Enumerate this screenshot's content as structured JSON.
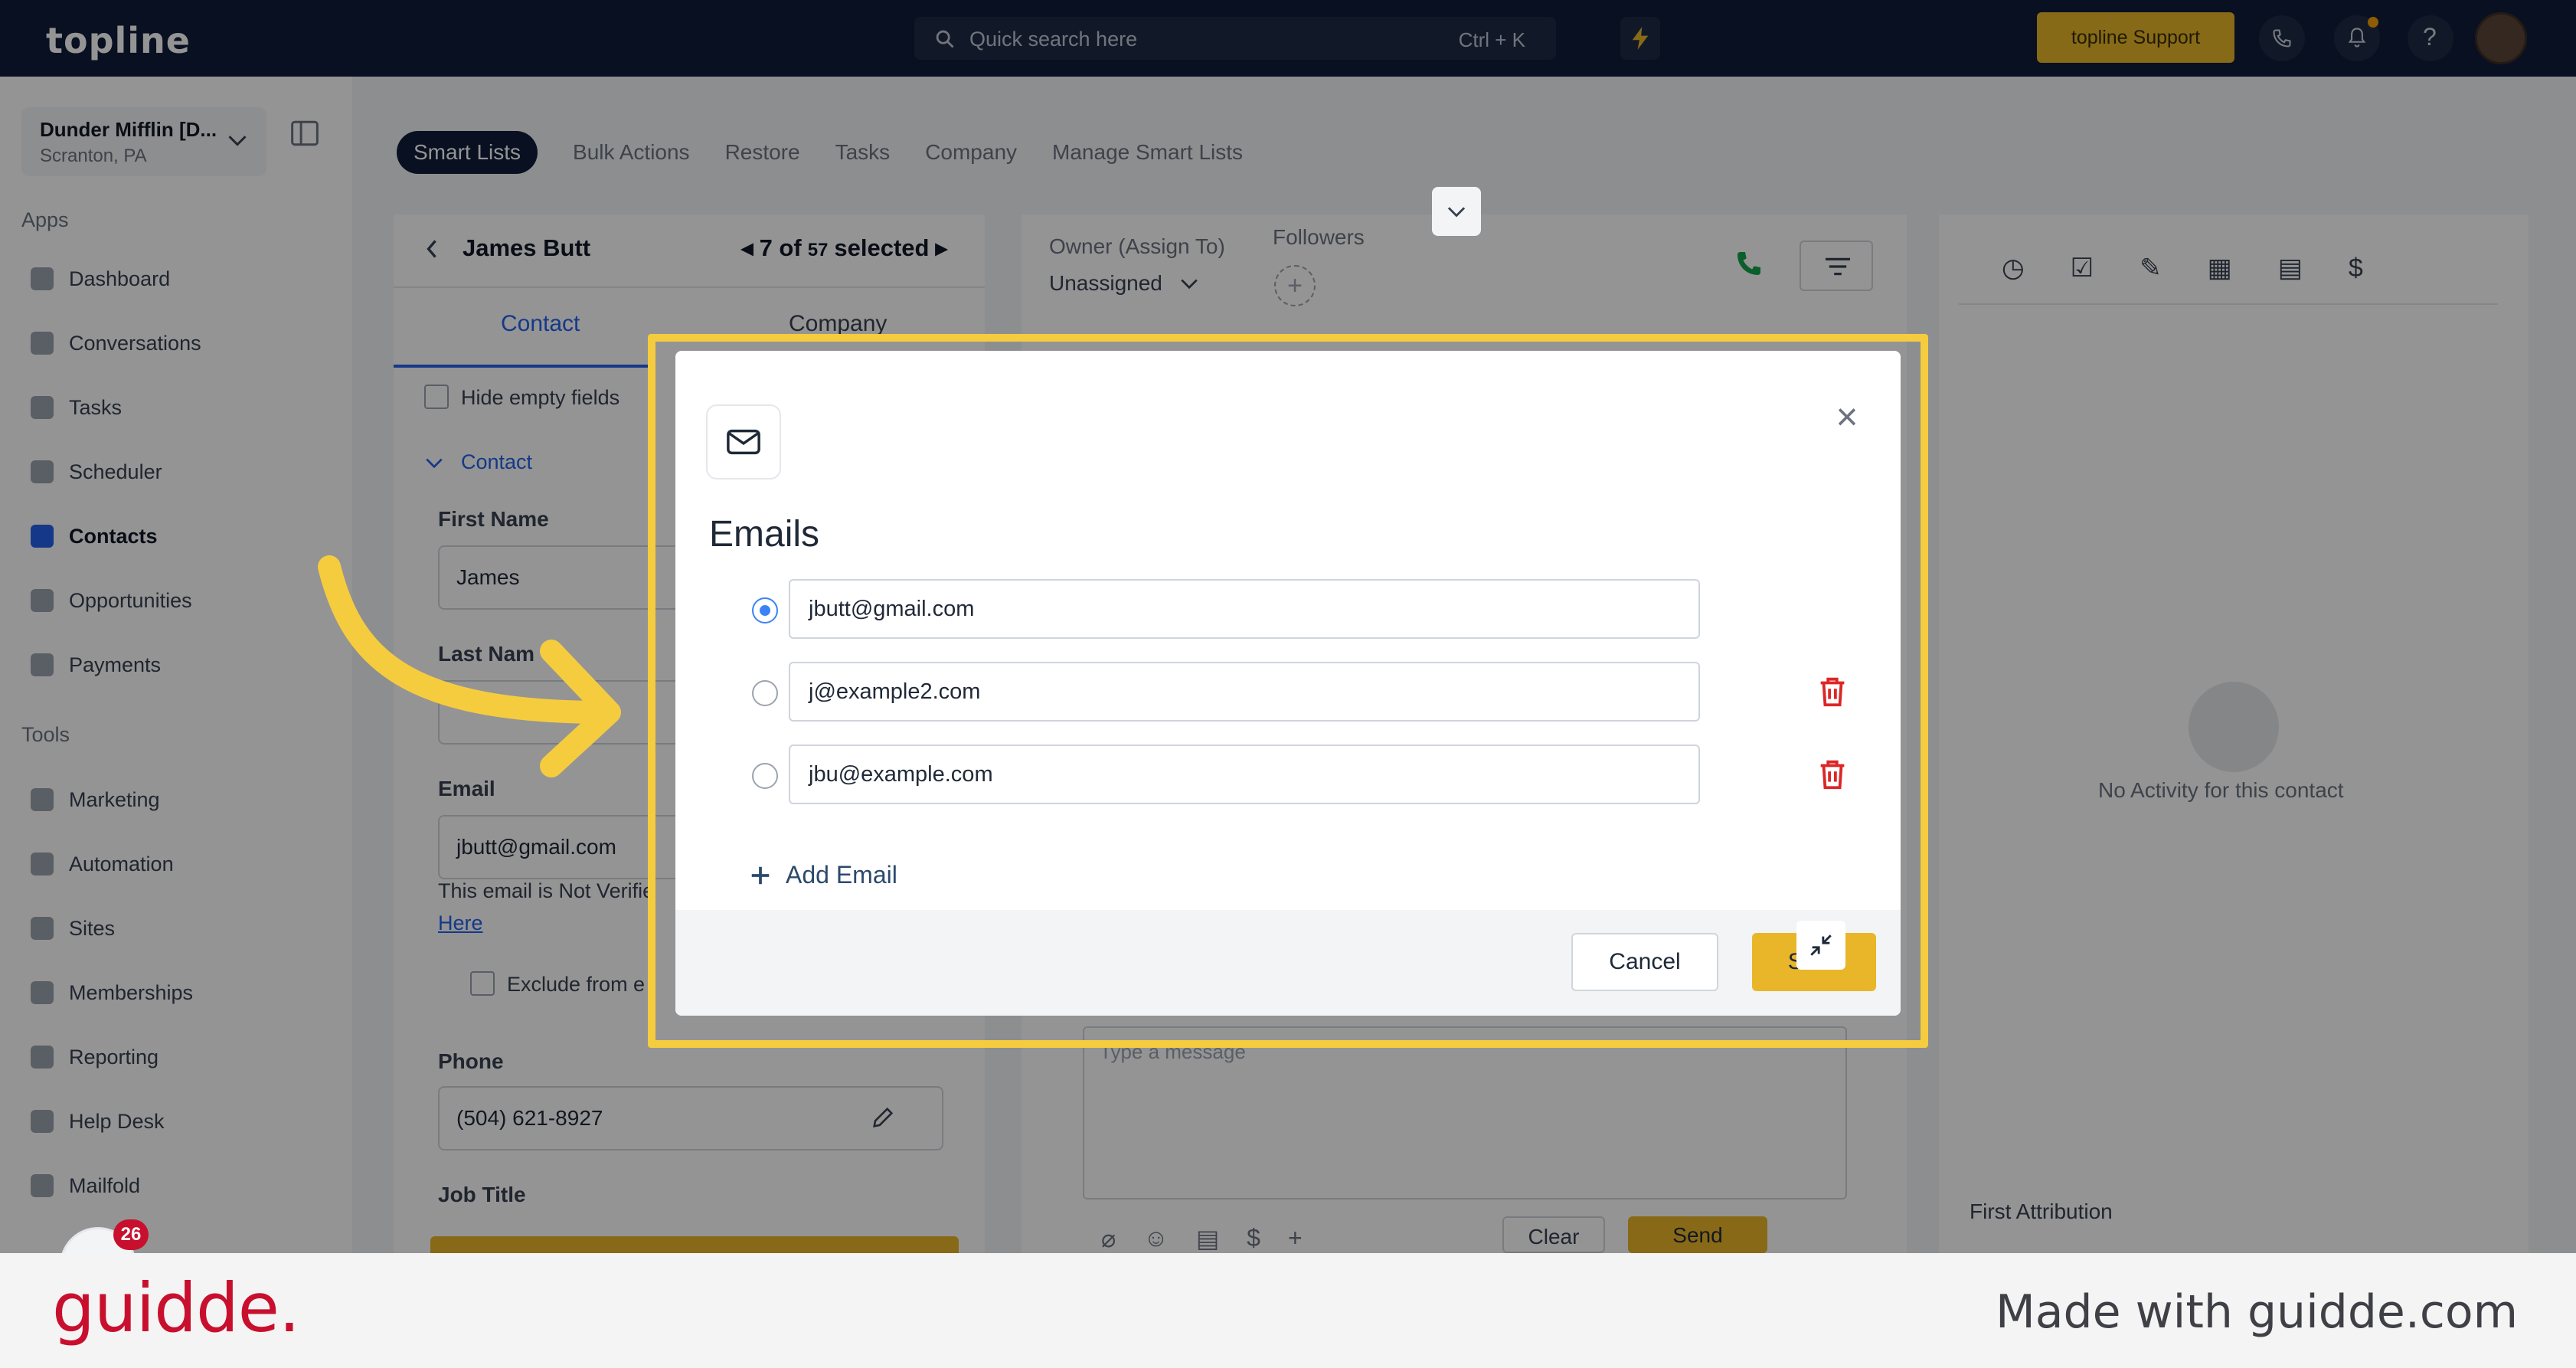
{
  "app": {
    "logo": "topline",
    "search_placeholder": "Quick search here",
    "search_shortcut": "Ctrl + K",
    "support_label": "topline Support"
  },
  "sidebar": {
    "account_name": "Dunder Mifflin [D...",
    "account_location": "Scranton, PA",
    "apps_heading": "Apps",
    "tools_heading": "Tools",
    "apps": [
      {
        "label": "Dashboard",
        "icon": "dashboard-icon"
      },
      {
        "label": "Conversations",
        "icon": "chat-icon"
      },
      {
        "label": "Tasks",
        "icon": "tasks-icon"
      },
      {
        "label": "Scheduler",
        "icon": "calendar-icon"
      },
      {
        "label": "Contacts",
        "icon": "contacts-icon"
      },
      {
        "label": "Opportunities",
        "icon": "opportunities-icon"
      },
      {
        "label": "Payments",
        "icon": "payments-icon"
      }
    ],
    "tools": [
      {
        "label": "Marketing",
        "icon": "megaphone-icon"
      },
      {
        "label": "Automation",
        "icon": "automation-icon"
      },
      {
        "label": "Sites",
        "icon": "globe-icon"
      },
      {
        "label": "Memberships",
        "icon": "memberships-icon"
      },
      {
        "label": "Reporting",
        "icon": "reporting-icon"
      },
      {
        "label": "Help Desk",
        "icon": "help-desk-icon"
      },
      {
        "label": "Mailfold",
        "icon": "mailfold-icon"
      }
    ],
    "notification_count": "26"
  },
  "tabs": [
    "Smart Lists",
    "Bulk Actions",
    "Restore",
    "Tasks",
    "Company",
    "Manage Smart Lists"
  ],
  "contact_panel": {
    "name": "James Butt",
    "selection_current": "7 of",
    "selection_total": "57",
    "selection_suffix": "selected",
    "tab_contact": "Contact",
    "tab_company": "Company",
    "hide_empty": "Hide empty fields",
    "section": "Contact",
    "first_name_label": "First Name",
    "first_name": "James",
    "last_name_label": "Last Nam",
    "email_label": "Email",
    "email": "jbutt@gmail.com",
    "email_note": "This email is Not Verifie",
    "email_link": "Here",
    "exclude_label": "Exclude from e",
    "phone_label": "Phone",
    "phone": "(504) 621-8927",
    "job_title_label": "Job Title"
  },
  "conversation_panel": {
    "owner_label": "Owner (Assign To)",
    "owner_value": "Unassigned",
    "followers_label": "Followers",
    "message_placeholder": "Type a message",
    "clear_label": "Clear",
    "send_label": "Send"
  },
  "activity_panel": {
    "empty_text": "No Activity for this contact",
    "first_attribution": "First Attribution"
  },
  "modal": {
    "title": "Emails",
    "emails": [
      {
        "value": "jbutt@gmail.com",
        "primary": true
      },
      {
        "value": "j@example2.com",
        "primary": false
      },
      {
        "value": "jbu@example.com",
        "primary": false
      }
    ],
    "add_email": "Add Email",
    "cancel": "Cancel",
    "save": "Save"
  },
  "footer": {
    "brand": "guidde.",
    "made_with": "Made with guidde.com"
  },
  "colors": {
    "topbar": "#0f1d3a",
    "accent": "#e8b628",
    "highlight": "#f6cc3f",
    "danger": "#dc2626",
    "brand_red": "#c8102e"
  }
}
